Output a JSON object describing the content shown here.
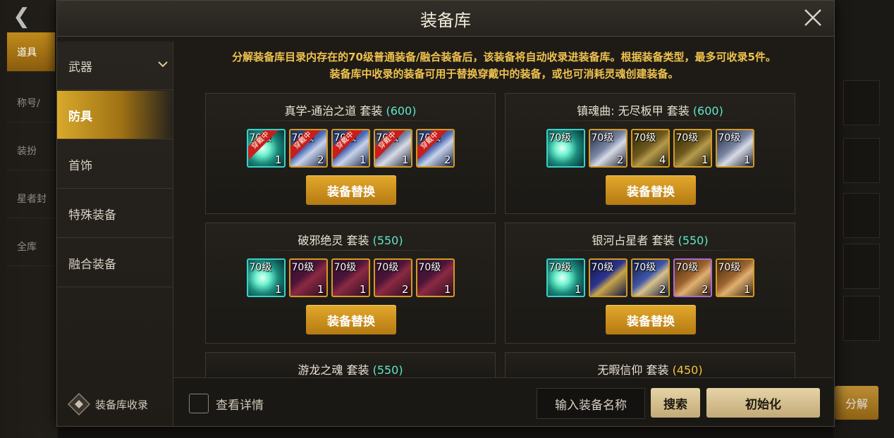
{
  "background": {
    "left_items": [
      "道具",
      "称号/",
      "装扮",
      "星者封",
      "全库"
    ],
    "divide_label": "分解"
  },
  "dialog": {
    "title": "装备库"
  },
  "sidebar": {
    "items": [
      {
        "label": "武器"
      },
      {
        "label": "防具"
      },
      {
        "label": "首饰"
      },
      {
        "label": "特殊装备"
      },
      {
        "label": "融合装备"
      }
    ],
    "footer_label": "装备库收录"
  },
  "notice": {
    "line1": "分解装备库目录内存在的70级普通装备/融合装备后，该装备将自动收录进装备库。根据装备类型，最多可收录5件。",
    "line2": "装备库中收录的装备可用于替换穿戴中的装备，或也可消耗灵魂创建装备。"
  },
  "sets": [
    {
      "name": "真学-通治之道 套装 ",
      "score": "(600)",
      "button": "装备替换",
      "items": [
        {
          "tag": "穿戴中",
          "level": "70级",
          "count": "1"
        },
        {
          "tag": "穿戴中",
          "level": "70级",
          "count": "2"
        },
        {
          "tag": "穿戴中",
          "level": "70级",
          "count": "1"
        },
        {
          "tag": "穿戴中",
          "level": "70级",
          "count": "1"
        },
        {
          "tag": "穿戴中",
          "level": "70级",
          "count": "2"
        }
      ]
    },
    {
      "name": "镇魂曲: 无尽板甲  套装 ",
      "score": "(600)",
      "button": "装备替换",
      "items": [
        {
          "level": "70级",
          "count": ""
        },
        {
          "level": "70级",
          "count": "2"
        },
        {
          "level": "70级",
          "count": "4"
        },
        {
          "level": "70级",
          "count": "1"
        },
        {
          "level": "70级",
          "count": "1"
        }
      ]
    },
    {
      "name": "破邪绝灵  套装 ",
      "score": "(550)",
      "button": "装备替换",
      "items": [
        {
          "level": "70级",
          "count": "1"
        },
        {
          "level": "70级",
          "count": "1"
        },
        {
          "level": "70级",
          "count": "1"
        },
        {
          "level": "70级",
          "count": "2"
        },
        {
          "level": "70级",
          "count": "1"
        }
      ]
    },
    {
      "name": "银河占星者  套装 ",
      "score": "(550)",
      "button": "装备替换",
      "items": [
        {
          "level": "70级",
          "count": "1"
        },
        {
          "level": "70级",
          "count": ""
        },
        {
          "level": "70级",
          "count": "2"
        },
        {
          "level": "70级",
          "count": "2"
        },
        {
          "level": "70级",
          "count": "1"
        }
      ]
    },
    {
      "name": "游龙之魂  套装 ",
      "score": "(550)"
    },
    {
      "name": "无暇信仰  套装 ",
      "score": "(450)"
    }
  ],
  "bottom": {
    "details_label": "查看详情",
    "search_placeholder": "输入装备名称",
    "search_button": "搜索",
    "reset_button": "初始化"
  },
  "colors": {
    "accent_gold": "#efc24e",
    "score_teal": "#62e5c8",
    "score_gold": "#f3c33f",
    "button_gold": "#d49a22"
  }
}
